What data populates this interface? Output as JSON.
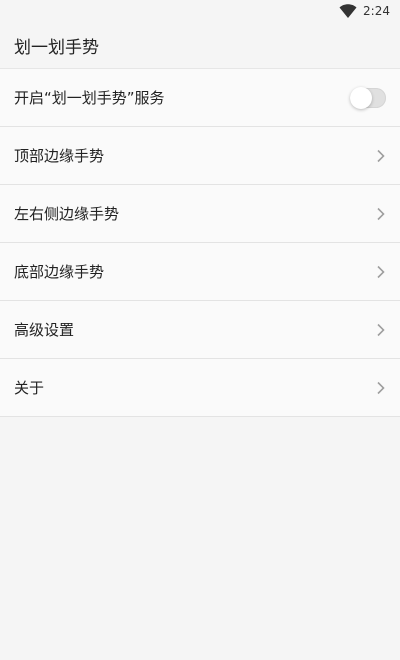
{
  "status_bar": {
    "time": "2:24",
    "icons": [
      "wifi-icon"
    ]
  },
  "app_bar": {
    "title": "划一划手势"
  },
  "settings": {
    "items": [
      {
        "label": "开启“划一划手势”服务",
        "control": "toggle",
        "enabled": false
      },
      {
        "label": "顶部边缘手势",
        "control": "chevron-right-icon"
      },
      {
        "label": "左右侧边缘手势",
        "control": "chevron-right-icon"
      },
      {
        "label": "底部边缘手势",
        "control": "chevron-right-icon"
      },
      {
        "label": "高级设置",
        "control": "chevron-right-icon"
      },
      {
        "label": "关于",
        "control": "chevron-right-icon"
      }
    ]
  },
  "colors": {
    "background": "#f5f5f5",
    "list_background": "#fafafa",
    "divider": "#e3e3e3",
    "toggle_off_track": "#e0e0e0",
    "text": "#222222",
    "chevron": "#9e9e9e"
  }
}
